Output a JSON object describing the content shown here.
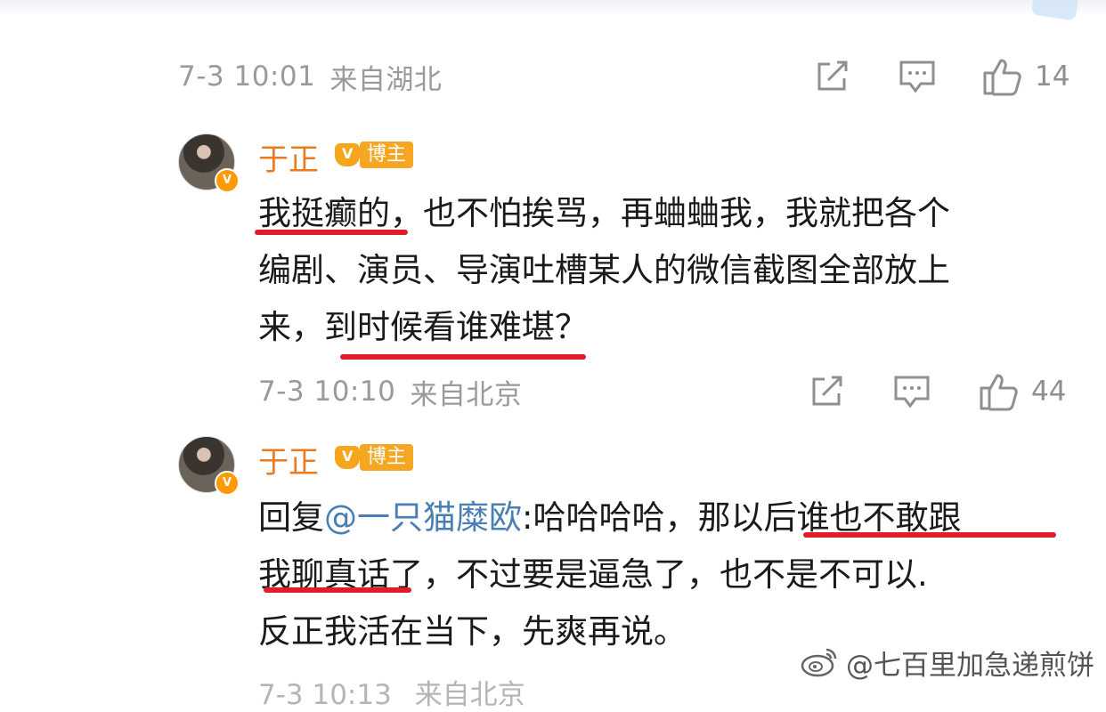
{
  "comments": [
    {
      "time": "7-3 10:01",
      "location": "来自湖北",
      "likes": "14"
    },
    {
      "username": "于正",
      "badge": "博主",
      "lines": [
        "我挺癫的，也不怕挨骂，再蛐蛐我，我就把各个",
        "编剧、演员、导演吐槽某人的微信截图全部放上",
        "来，到时候看谁难堪？"
      ],
      "time": "7-3 10:10",
      "location": "来自北京",
      "likes": "44"
    },
    {
      "username": "于正",
      "badge": "博主",
      "reply_prefix": "回复",
      "mention": "@一只猫糜欧",
      "line1_rest": ":哈哈哈哈，那以后谁也不敢跟",
      "line2": "我聊真话了，不过要是逼急了，也不是不可以.",
      "line3": "反正我活在当下，先爽再说。",
      "time_partial": "7-3 10:13",
      "location_partial": "来自北京"
    }
  ],
  "watermark": "@七百里加急递煎饼",
  "icons": {
    "share": "share-icon",
    "comment": "comment-icon",
    "like": "thumbs-up-icon",
    "weibo": "weibo-logo-icon"
  },
  "colors": {
    "username": "#ec7a1e",
    "mention": "#4a7fb5",
    "underline": "#e11d2a",
    "meta": "#9a9a9a"
  }
}
